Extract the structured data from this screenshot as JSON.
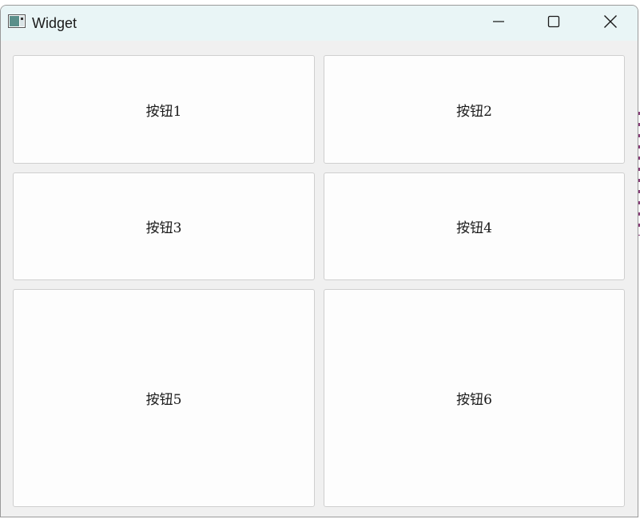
{
  "window": {
    "title": "Widget",
    "controls": {
      "minimize_icon": "minimize-icon",
      "maximize_icon": "maximize-icon",
      "close_icon": "close-icon"
    }
  },
  "buttons": [
    {
      "label": "按钮1"
    },
    {
      "label": "按钮2"
    },
    {
      "label": "按钮3"
    },
    {
      "label": "按钮4"
    },
    {
      "label": "按钮5"
    },
    {
      "label": "按钮6"
    }
  ],
  "colors": {
    "titlebar": "#e9f5f6",
    "client": "#f0f0f0",
    "button_face": "#fdfdfd",
    "button_border": "#cfcfcf"
  }
}
